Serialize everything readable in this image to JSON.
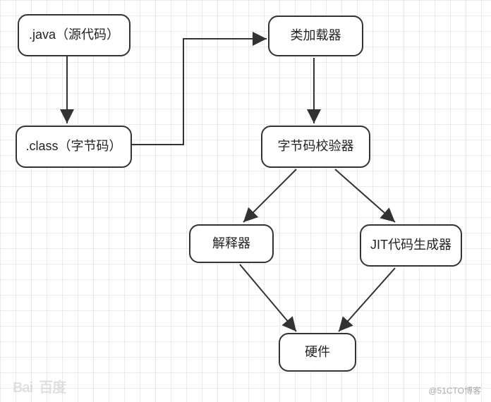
{
  "nodes": {
    "source": ".java（源代码）",
    "class": ".class（字节码）",
    "classloader": "类加载器",
    "verifier": "字节码校验器",
    "interpreter": "解释器",
    "jit": "JIT代码生成器",
    "hardware": "硬件"
  },
  "watermark": {
    "left": "Bai  百度",
    "right": "@51CTO博客"
  },
  "diagram": {
    "flow": [
      [
        "source",
        "class"
      ],
      [
        "class",
        "classloader"
      ],
      [
        "classloader",
        "verifier"
      ],
      [
        "verifier",
        "interpreter"
      ],
      [
        "verifier",
        "jit"
      ],
      [
        "interpreter",
        "hardware"
      ],
      [
        "jit",
        "hardware"
      ]
    ]
  }
}
